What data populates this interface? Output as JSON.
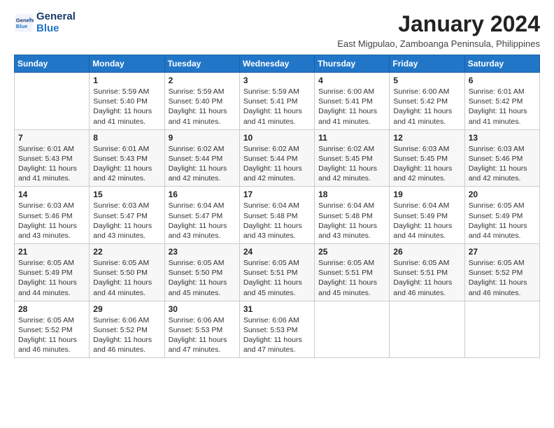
{
  "app": {
    "logo_line1": "General",
    "logo_line2": "Blue"
  },
  "calendar": {
    "title": "January 2024",
    "subtitle": "East Migpulao, Zamboanga Peninsula, Philippines",
    "headers": [
      "Sunday",
      "Monday",
      "Tuesday",
      "Wednesday",
      "Thursday",
      "Friday",
      "Saturday"
    ],
    "weeks": [
      [
        {
          "day": "",
          "info": ""
        },
        {
          "day": "1",
          "info": "Sunrise: 5:59 AM\nSunset: 5:40 PM\nDaylight: 11 hours\nand 41 minutes."
        },
        {
          "day": "2",
          "info": "Sunrise: 5:59 AM\nSunset: 5:40 PM\nDaylight: 11 hours\nand 41 minutes."
        },
        {
          "day": "3",
          "info": "Sunrise: 5:59 AM\nSunset: 5:41 PM\nDaylight: 11 hours\nand 41 minutes."
        },
        {
          "day": "4",
          "info": "Sunrise: 6:00 AM\nSunset: 5:41 PM\nDaylight: 11 hours\nand 41 minutes."
        },
        {
          "day": "5",
          "info": "Sunrise: 6:00 AM\nSunset: 5:42 PM\nDaylight: 11 hours\nand 41 minutes."
        },
        {
          "day": "6",
          "info": "Sunrise: 6:01 AM\nSunset: 5:42 PM\nDaylight: 11 hours\nand 41 minutes."
        }
      ],
      [
        {
          "day": "7",
          "info": "Sunrise: 6:01 AM\nSunset: 5:43 PM\nDaylight: 11 hours\nand 41 minutes."
        },
        {
          "day": "8",
          "info": "Sunrise: 6:01 AM\nSunset: 5:43 PM\nDaylight: 11 hours\nand 42 minutes."
        },
        {
          "day": "9",
          "info": "Sunrise: 6:02 AM\nSunset: 5:44 PM\nDaylight: 11 hours\nand 42 minutes."
        },
        {
          "day": "10",
          "info": "Sunrise: 6:02 AM\nSunset: 5:44 PM\nDaylight: 11 hours\nand 42 minutes."
        },
        {
          "day": "11",
          "info": "Sunrise: 6:02 AM\nSunset: 5:45 PM\nDaylight: 11 hours\nand 42 minutes."
        },
        {
          "day": "12",
          "info": "Sunrise: 6:03 AM\nSunset: 5:45 PM\nDaylight: 11 hours\nand 42 minutes."
        },
        {
          "day": "13",
          "info": "Sunrise: 6:03 AM\nSunset: 5:46 PM\nDaylight: 11 hours\nand 42 minutes."
        }
      ],
      [
        {
          "day": "14",
          "info": "Sunrise: 6:03 AM\nSunset: 5:46 PM\nDaylight: 11 hours\nand 43 minutes."
        },
        {
          "day": "15",
          "info": "Sunrise: 6:03 AM\nSunset: 5:47 PM\nDaylight: 11 hours\nand 43 minutes."
        },
        {
          "day": "16",
          "info": "Sunrise: 6:04 AM\nSunset: 5:47 PM\nDaylight: 11 hours\nand 43 minutes."
        },
        {
          "day": "17",
          "info": "Sunrise: 6:04 AM\nSunset: 5:48 PM\nDaylight: 11 hours\nand 43 minutes."
        },
        {
          "day": "18",
          "info": "Sunrise: 6:04 AM\nSunset: 5:48 PM\nDaylight: 11 hours\nand 43 minutes."
        },
        {
          "day": "19",
          "info": "Sunrise: 6:04 AM\nSunset: 5:49 PM\nDaylight: 11 hours\nand 44 minutes."
        },
        {
          "day": "20",
          "info": "Sunrise: 6:05 AM\nSunset: 5:49 PM\nDaylight: 11 hours\nand 44 minutes."
        }
      ],
      [
        {
          "day": "21",
          "info": "Sunrise: 6:05 AM\nSunset: 5:49 PM\nDaylight: 11 hours\nand 44 minutes."
        },
        {
          "day": "22",
          "info": "Sunrise: 6:05 AM\nSunset: 5:50 PM\nDaylight: 11 hours\nand 44 minutes."
        },
        {
          "day": "23",
          "info": "Sunrise: 6:05 AM\nSunset: 5:50 PM\nDaylight: 11 hours\nand 45 minutes."
        },
        {
          "day": "24",
          "info": "Sunrise: 6:05 AM\nSunset: 5:51 PM\nDaylight: 11 hours\nand 45 minutes."
        },
        {
          "day": "25",
          "info": "Sunrise: 6:05 AM\nSunset: 5:51 PM\nDaylight: 11 hours\nand 45 minutes."
        },
        {
          "day": "26",
          "info": "Sunrise: 6:05 AM\nSunset: 5:51 PM\nDaylight: 11 hours\nand 46 minutes."
        },
        {
          "day": "27",
          "info": "Sunrise: 6:05 AM\nSunset: 5:52 PM\nDaylight: 11 hours\nand 46 minutes."
        }
      ],
      [
        {
          "day": "28",
          "info": "Sunrise: 6:05 AM\nSunset: 5:52 PM\nDaylight: 11 hours\nand 46 minutes."
        },
        {
          "day": "29",
          "info": "Sunrise: 6:06 AM\nSunset: 5:52 PM\nDaylight: 11 hours\nand 46 minutes."
        },
        {
          "day": "30",
          "info": "Sunrise: 6:06 AM\nSunset: 5:53 PM\nDaylight: 11 hours\nand 47 minutes."
        },
        {
          "day": "31",
          "info": "Sunrise: 6:06 AM\nSunset: 5:53 PM\nDaylight: 11 hours\nand 47 minutes."
        },
        {
          "day": "",
          "info": ""
        },
        {
          "day": "",
          "info": ""
        },
        {
          "day": "",
          "info": ""
        }
      ]
    ]
  }
}
